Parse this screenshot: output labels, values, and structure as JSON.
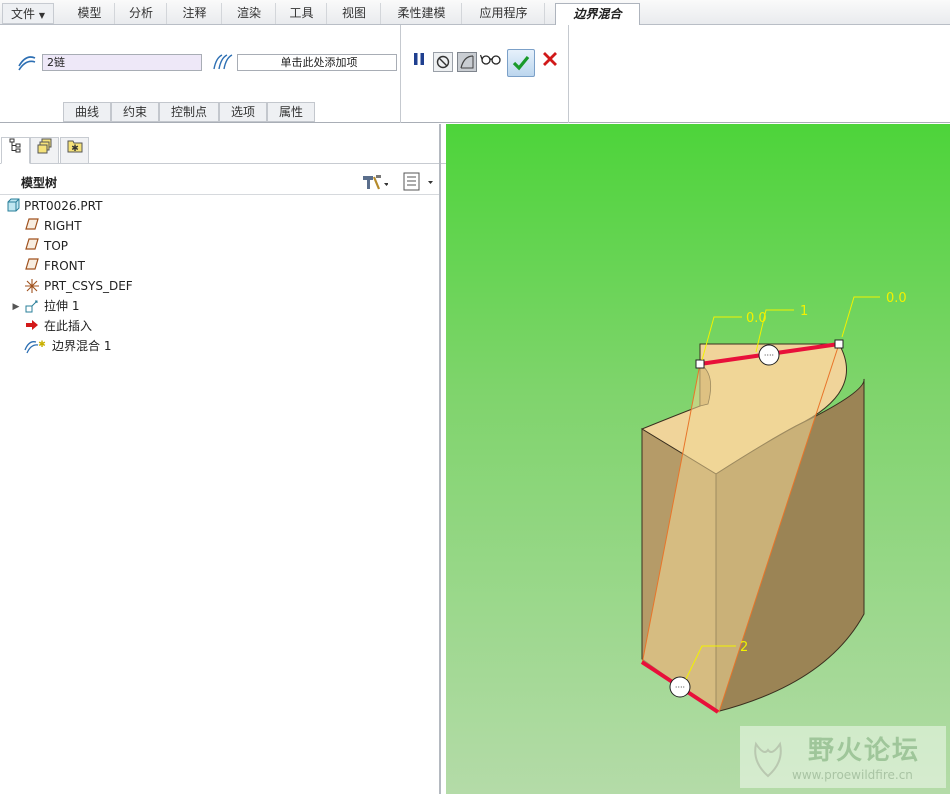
{
  "menubar": {
    "file": "文件",
    "tabs": [
      "模型",
      "分析",
      "注释",
      "渲染",
      "工具",
      "视图",
      "柔性建模",
      "应用程序"
    ],
    "active_tab": "边界混合"
  },
  "ribbon": {
    "first_dir_value": "2链",
    "second_dir_placeholder": "单击此处添加项",
    "subtabs": [
      "曲线",
      "约束",
      "控制点",
      "选项",
      "属性"
    ],
    "colors": {
      "ok": "#1a9a2a",
      "cancel": "#d11919",
      "pause": "#1f3f8f"
    }
  },
  "left_pane": {
    "tab_icons": [
      "model-tree-icon",
      "layer-icon",
      "favorites-icon"
    ],
    "tree_title": "模型树",
    "nodes": [
      {
        "label": "PRT0026.PRT",
        "icon": "part-icon",
        "indent": 0,
        "expand": false
      },
      {
        "label": "RIGHT",
        "icon": "datum-plane-icon",
        "indent": 1,
        "expand": false
      },
      {
        "label": "TOP",
        "icon": "datum-plane-icon",
        "indent": 1,
        "expand": false
      },
      {
        "label": "FRONT",
        "icon": "datum-plane-icon",
        "indent": 1,
        "expand": false
      },
      {
        "label": "PRT_CSYS_DEF",
        "icon": "csys-icon",
        "indent": 1,
        "expand": false
      },
      {
        "label": "拉伸 1",
        "icon": "extrude-icon",
        "indent": 1,
        "expand": true
      },
      {
        "label": "在此插入",
        "icon": "insert-arrow-icon",
        "indent": 1,
        "expand": false
      },
      {
        "label": "边界混合 1",
        "icon": "boundary-blend-icon",
        "indent": 1,
        "expand": false
      }
    ]
  },
  "viewport": {
    "labels": {
      "top_left_value": "0.0",
      "top_right_value": "0.0",
      "chain_1": "1",
      "chain_2": "2"
    },
    "colors": {
      "bg_top": "#4dd43a",
      "bg_bottom": "#b4dba8",
      "body": "#a89060",
      "chain": "#e8103a",
      "annot": "#f2f200"
    }
  },
  "watermark": {
    "title": "野火论坛",
    "url": "www.proewildfire.cn"
  }
}
